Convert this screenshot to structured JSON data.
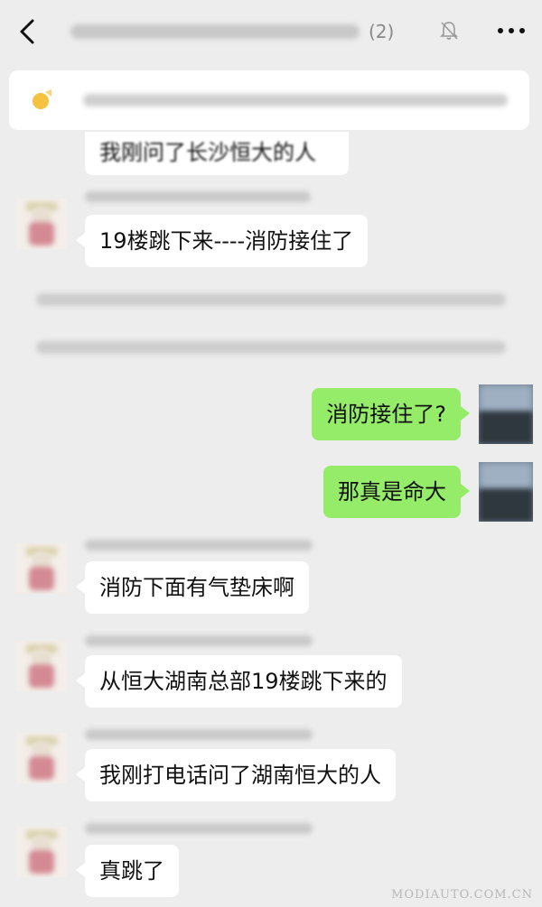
{
  "header": {
    "title_count": "(2)"
  },
  "messages": [
    {
      "id": "m0",
      "side": "left",
      "partial": true,
      "text": "我刚问了长沙恒大的人"
    },
    {
      "id": "m1",
      "side": "left",
      "text": "19楼跳下来----消防接住了"
    },
    {
      "id": "m2",
      "side": "right",
      "text": "消防接住了?"
    },
    {
      "id": "m3",
      "side": "right",
      "text": "那真是命大"
    },
    {
      "id": "m4",
      "side": "left",
      "text": "消防下面有气垫床啊"
    },
    {
      "id": "m5",
      "side": "left",
      "text": "从恒大湖南总部19楼跳下来的"
    },
    {
      "id": "m6",
      "side": "left",
      "text": "我刚打电话问了湖南恒大的人"
    },
    {
      "id": "m7",
      "side": "left",
      "text": "真跳了"
    }
  ],
  "watermark": "MODIAUTO.COM.CN",
  "colors": {
    "background": "#ededed",
    "bubble_self": "#95ec69",
    "bubble_other": "#ffffff"
  },
  "icons": [
    "back-icon",
    "mute-bell-icon",
    "more-icon",
    "announcement-icon"
  ]
}
